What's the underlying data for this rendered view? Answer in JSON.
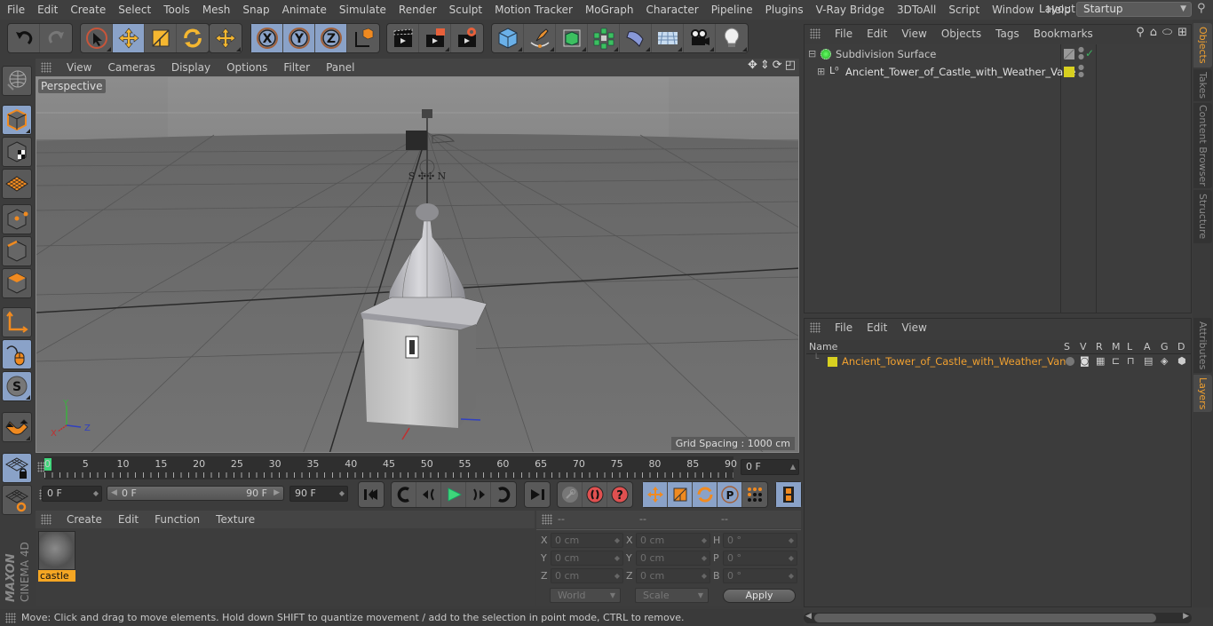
{
  "menubar": {
    "items": [
      "File",
      "Edit",
      "Create",
      "Select",
      "Tools",
      "Mesh",
      "Snap",
      "Animate",
      "Simulate",
      "Render",
      "Sculpt",
      "Motion Tracker",
      "MoGraph",
      "Character",
      "Pipeline",
      "Plugins",
      "V-Ray Bridge",
      "3DToAll",
      "Script",
      "Window",
      "Help"
    ],
    "layout_label": "Layout:",
    "layout_value": "Startup"
  },
  "toolbar": {
    "groups": [
      {
        "name": "history",
        "buttons": [
          "undo-icon",
          "redo-icon"
        ]
      },
      {
        "name": "transform",
        "buttons": [
          "live-selection-icon",
          "move-icon",
          "scale-icon",
          "rotate-icon"
        ]
      },
      {
        "name": "recent",
        "buttons": [
          "move-recent-icon"
        ]
      },
      {
        "name": "axis",
        "buttons": [
          "x-axis-icon",
          "y-axis-icon",
          "z-axis-icon",
          "coordinate-system-icon"
        ]
      },
      {
        "name": "render",
        "buttons": [
          "render-view-icon",
          "render-picture-viewer-icon",
          "render-settings-icon"
        ]
      },
      {
        "name": "create",
        "buttons": [
          "cube-icon",
          "pen-spline-icon",
          "subdivision-icon",
          "array-icon",
          "deformer-icon",
          "floor-icon",
          "camera-icon",
          "light-icon"
        ]
      }
    ]
  },
  "viewport": {
    "menu": [
      "View",
      "Cameras",
      "Display",
      "Options",
      "Filter",
      "Panel"
    ],
    "camera_label": "Perspective",
    "grid_spacing": "Grid Spacing : 1000 cm",
    "axis_labels": {
      "x": "X",
      "y": "Y",
      "z": "Z"
    }
  },
  "timeline": {
    "ticks": [
      "0",
      "5",
      "10",
      "15",
      "20",
      "25",
      "30",
      "35",
      "40",
      "45",
      "50",
      "55",
      "60",
      "65",
      "70",
      "75",
      "80",
      "85",
      "90"
    ],
    "current_frame": "0 F",
    "start_frame": "0 F",
    "range_start": "0 F",
    "range_end": "90 F",
    "end_frame": "90 F",
    "current_display": "0 F"
  },
  "materials": {
    "menu": [
      "Create",
      "Edit",
      "Function",
      "Texture"
    ],
    "items": [
      {
        "name": "castle"
      }
    ]
  },
  "coordinates": {
    "headers": [
      "--",
      "--",
      "--"
    ],
    "position": [
      {
        "axis": "X",
        "value": "0 cm"
      },
      {
        "axis": "Y",
        "value": "0 cm"
      },
      {
        "axis": "Z",
        "value": "0 cm"
      }
    ],
    "size": [
      {
        "axis": "X",
        "value": "0 cm"
      },
      {
        "axis": "Y",
        "value": "0 cm"
      },
      {
        "axis": "Z",
        "value": "0 cm"
      }
    ],
    "rotation": [
      {
        "axis": "H",
        "value": "0 °"
      },
      {
        "axis": "P",
        "value": "0 °"
      },
      {
        "axis": "B",
        "value": "0 °"
      }
    ],
    "mode_dropdown": "World",
    "size_dropdown": "Scale",
    "apply_label": "Apply"
  },
  "status": {
    "text": "Move: Click and drag to move elements. Hold down SHIFT to quantize movement / add to the selection in point mode, CTRL to remove."
  },
  "objects_panel": {
    "menu": [
      "File",
      "Edit",
      "View",
      "Objects",
      "Tags",
      "Bookmarks"
    ],
    "objects": [
      {
        "name": "Subdivision Surface",
        "level": 0,
        "expanded": true,
        "color": "#bbbbbb"
      },
      {
        "name": "Ancient_Tower_of_Castle_with_Weather_Vane",
        "level": 1,
        "expanded": false,
        "color": "#e0e0e0",
        "layer_color": "#d8d020"
      }
    ]
  },
  "layers_panel": {
    "menu": [
      "File",
      "Edit",
      "View"
    ],
    "columns": [
      "Name",
      "S",
      "V",
      "R",
      "M",
      "L",
      "A",
      "G",
      "D"
    ],
    "layers": [
      {
        "name": "Ancient_Tower_of_Castle_with_Weather_Vane",
        "color": "#d8d020",
        "text_color": "#f0a030"
      }
    ]
  },
  "side_tabs": {
    "top": [
      {
        "label": "Objects",
        "active": true
      },
      {
        "label": "Takes",
        "active": false
      },
      {
        "label": "Content Browser",
        "active": false
      },
      {
        "label": "Structure",
        "active": false
      }
    ],
    "bottom": [
      {
        "label": "Attributes",
        "active": false
      },
      {
        "label": "Layers",
        "active": true
      }
    ]
  },
  "branding": {
    "maxon": "MAXON",
    "product": "CINEMA 4D"
  },
  "colors": {
    "accent_blue": "#8aa2c8",
    "accent_orange": "#f0a030",
    "layer_yellow": "#d8d020",
    "timeline_marker": "#3ed67a"
  }
}
